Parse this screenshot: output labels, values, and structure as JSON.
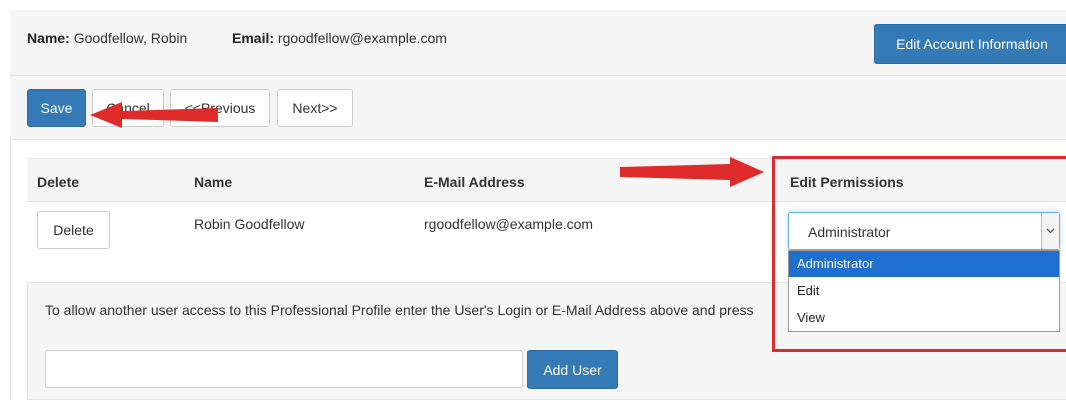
{
  "account": {
    "name_label": "Name:",
    "name_value": "Goodfellow, Robin",
    "email_label": "Email:",
    "email_value": "rgoodfellow@example.com",
    "edit_button": "Edit Account Information"
  },
  "toolbar": {
    "save_label": "Save",
    "cancel_label": "Cancel",
    "previous_label": "<<Previous",
    "next_label": "Next>>"
  },
  "table": {
    "headers": [
      "Delete",
      "Name",
      "E-Mail Address",
      "Edit Permissions"
    ],
    "rows": [
      {
        "delete_label": "Delete",
        "name": "Robin Goodfellow",
        "email": "rgoodfellow@example.com",
        "permission": "Administrator"
      }
    ]
  },
  "permissions_dropdown": {
    "options": [
      "Administrator",
      "Edit",
      "View"
    ],
    "selected": "Administrator"
  },
  "add_user": {
    "instructions": "To allow another user access to this Professional Profile enter the User's Login or E-Mail Address above and press",
    "input_value": "",
    "input_placeholder": "",
    "button_label": "Add User"
  },
  "annotations": {
    "arrow_color": "#e02b2b",
    "highlight_color": "#e02b2b"
  },
  "colors": {
    "primary": "#337ab7",
    "panel_bg": "#f5f5f5",
    "selected_option": "#1e6fd0"
  }
}
